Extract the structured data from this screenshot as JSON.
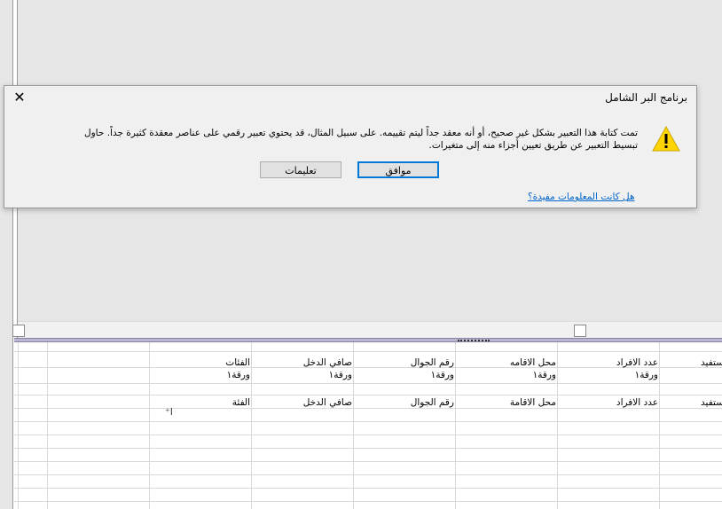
{
  "dialog": {
    "title": "برنامج البر الشامل",
    "message": "تمت كتابة هذا التعبير بشكل غير صحيح، أو أنه معقد جداً ليتم تقييمه. على سبيل المثال، قد يحتوي تعبير رقمي على عناصر معقدة كثيرة جداً. حاول تبسيط التعبير عن طريق تعيين أجزاء منه إلى متغيرات.",
    "ok_label": "موافق",
    "help_label": "تعليمات",
    "feedback_link": "هل كانت المعلومات مفيدة؟",
    "close_glyph": "✕"
  },
  "grid": {
    "row1": [
      "ستفيد",
      "عدد الافراد",
      "محل الاقامه",
      "رقم الجوال",
      "صافي الدخل",
      "الفئات"
    ],
    "row2": [
      "",
      "ورقة١",
      "ورقة١",
      "ورقة١",
      "ورقة١",
      "ورقة١"
    ],
    "row3": [
      "ستفيد",
      "عدد الافراد",
      "محل الاقامة",
      "رقم الجوال",
      "صافي الدخل",
      "الفئة"
    ]
  }
}
